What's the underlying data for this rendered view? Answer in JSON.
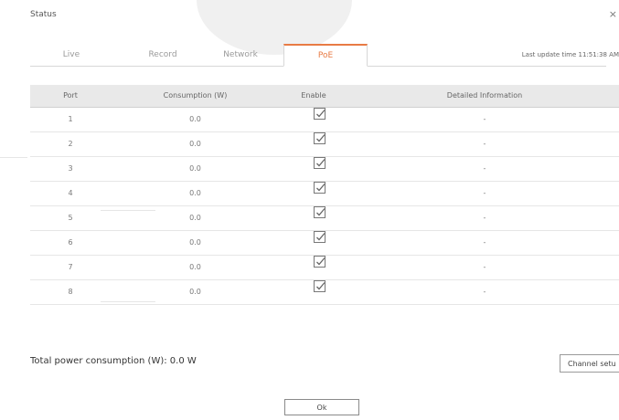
{
  "window": {
    "title": "Status",
    "close_glyph": "×"
  },
  "tabs": [
    {
      "label": "Live"
    },
    {
      "label": "Record"
    },
    {
      "label": "Network"
    },
    {
      "label": "PoE",
      "active": true
    }
  ],
  "last_update": "Last update time 11:51:38 AM",
  "table": {
    "headers": [
      "Port",
      "Consumption (W)",
      "Enable",
      "Detailed Information"
    ],
    "rows": [
      {
        "port": "1",
        "consumption": "0.0",
        "enabled": true,
        "info": "-"
      },
      {
        "port": "2",
        "consumption": "0.0",
        "enabled": true,
        "info": "-"
      },
      {
        "port": "3",
        "consumption": "0.0",
        "enabled": true,
        "info": "-"
      },
      {
        "port": "4",
        "consumption": "0.0",
        "enabled": true,
        "info": "-"
      },
      {
        "port": "5",
        "consumption": "0.0",
        "enabled": true,
        "info": "-"
      },
      {
        "port": "6",
        "consumption": "0.0",
        "enabled": true,
        "info": "-"
      },
      {
        "port": "7",
        "consumption": "0.0",
        "enabled": true,
        "info": "-"
      },
      {
        "port": "8",
        "consumption": "0.0",
        "enabled": true,
        "info": "-"
      }
    ]
  },
  "total": "Total power consumption (W): 0.0 W",
  "buttons": {
    "channel_setup": "Channel setu",
    "ok": "Ok"
  },
  "colors": {
    "accent": "#e87b44",
    "header_bg": "#e9e9e9"
  }
}
